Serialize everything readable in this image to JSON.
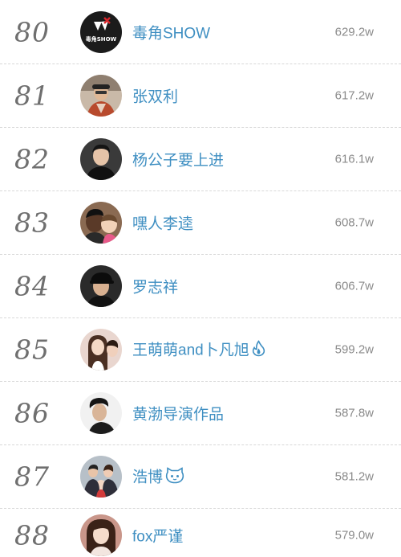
{
  "ranking": {
    "rows": [
      {
        "rank": "80",
        "name": "毒角SHOW",
        "count": "629.2w",
        "avatar": {
          "icon": "avatar-logo-unicorn",
          "bg": "#1b1b1b",
          "logo_text": "毒角SHOW"
        }
      },
      {
        "rank": "81",
        "name": "张双利",
        "count": "617.2w",
        "avatar": {
          "icon": "avatar-man-cap",
          "bg": "#c9b9a8"
        }
      },
      {
        "rank": "82",
        "name": "杨公子要上进",
        "count": "616.1w",
        "avatar": {
          "icon": "avatar-man-dark",
          "bg": "#3a3a3a"
        }
      },
      {
        "rank": "83",
        "name": "嘿人李逵",
        "count": "608.7w",
        "avatar": {
          "icon": "avatar-man-child",
          "bg": "#8a6a52"
        }
      },
      {
        "rank": "84",
        "name": "罗志祥",
        "count": "606.7w",
        "avatar": {
          "icon": "avatar-man-cap-dark",
          "bg": "#2a2a2a"
        }
      },
      {
        "rank": "85",
        "name": "王萌萌and卜凡旭",
        "count": "599.2w",
        "avatar": {
          "icon": "avatar-woman-long-hair",
          "bg": "#e9d6cf"
        },
        "badge": "flame-icon"
      },
      {
        "rank": "86",
        "name": "黄渤导演作品",
        "count": "587.8w",
        "avatar": {
          "icon": "avatar-man-profile",
          "bg": "#f1f1f1"
        }
      },
      {
        "rank": "87",
        "name": "浩博",
        "count": "581.2w",
        "avatar": {
          "icon": "avatar-family",
          "bg": "#b7c0c8"
        },
        "badge": "cat-face-icon"
      },
      {
        "rank": "88",
        "name": "fox严谨",
        "count": "579.0w",
        "avatar": {
          "icon": "avatar-woman-portrait",
          "bg": "#c9968a"
        }
      }
    ]
  }
}
